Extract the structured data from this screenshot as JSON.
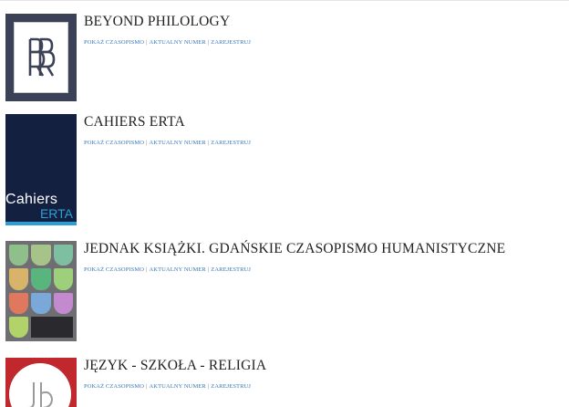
{
  "links": {
    "show": "POKAŻ CZASOPISMO",
    "current": "AKTUALNY NUMER",
    "register": "ZAREJESTRUJ",
    "separator": "|"
  },
  "journals": [
    {
      "title": "BEYOND PHILOLOGY",
      "cover": {
        "icon": "bp-monogram-icon"
      }
    },
    {
      "title": "CAHIERS ERTA",
      "cover": {
        "word1": "Cahiers",
        "word2": "ERTA"
      }
    },
    {
      "title": "JEDNAK KSIĄŻKI. GDAŃSKIE CZASOPISMO HUMANISTYCZNE",
      "cover": {
        "colors": [
          "#8fbf8a",
          "#a6c48a",
          "#7dbf9e",
          "#d8b46a",
          "#59b57d",
          "#9ecf7a",
          "#e0785e",
          "#7aa8d8",
          "#c38ad0",
          "#b2d26a",
          "#e49a6a"
        ]
      }
    },
    {
      "title": "JĘZYK - SZKOŁA - RELIGIA",
      "cover": {
        "icon": "jsr-monogram-icon"
      }
    }
  ],
  "colors": {
    "link": "#3a76b8",
    "title": "#222222",
    "erta_blue": "#2aa0d8",
    "erta_navy": "#14203f"
  }
}
